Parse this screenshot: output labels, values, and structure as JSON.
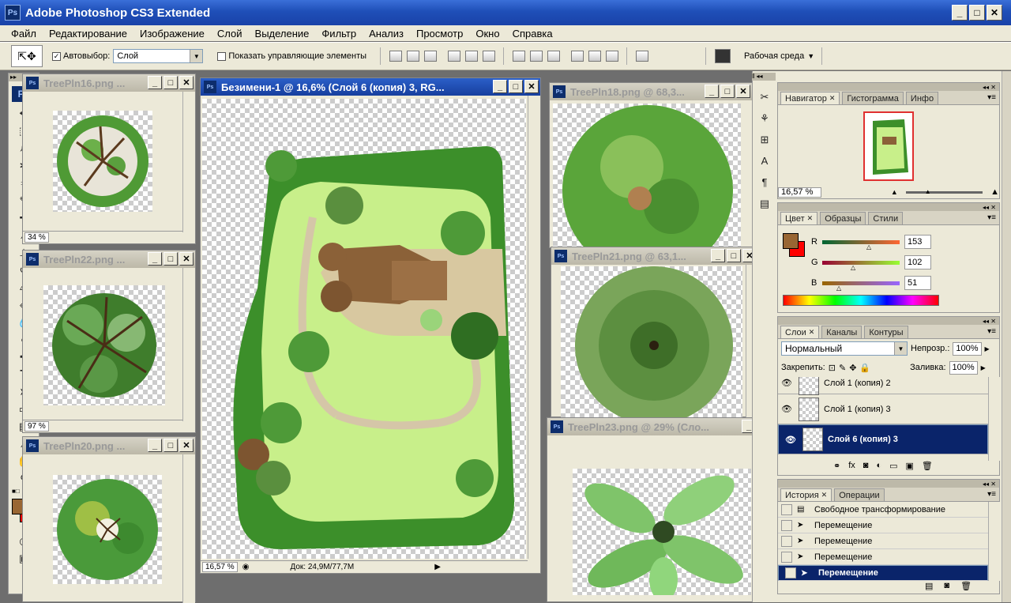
{
  "app": {
    "title": "Adobe Photoshop CS3 Extended",
    "logo": "Ps"
  },
  "menu": [
    "Файл",
    "Редактирование",
    "Изображение",
    "Слой",
    "Выделение",
    "Фильтр",
    "Анализ",
    "Просмотр",
    "Окно",
    "Справка"
  ],
  "options": {
    "auto_select_label": "Автовыбор:",
    "auto_select_value": "Слой",
    "show_controls_label": "Показать управляющие элементы",
    "workspace_label": "Рабочая среда"
  },
  "documents": {
    "tree16": {
      "title": "TreePln16.png ...",
      "zoom": "34 %"
    },
    "tree22": {
      "title": "TreePln22.png ...",
      "zoom": "97 %"
    },
    "tree20": {
      "title": "TreePln20.png ..."
    },
    "main": {
      "title": "Безимени-1 @ 16,6% (Слой 6 (копия) 3, RG...",
      "zoom": "16,57 %",
      "doc_info": "Док: 24,9M/77,7M"
    },
    "tree18": {
      "title": "TreePln18.png @ 68,3..."
    },
    "tree21": {
      "title": "TreePln21.png @ 63,1..."
    },
    "tree23": {
      "title": "TreePln23.png @ 29% (Сло..."
    }
  },
  "navigator": {
    "tabs": [
      "Навигатор",
      "Гистограмма",
      "Инфо"
    ],
    "zoom": "16,57 %"
  },
  "color": {
    "tabs": [
      "Цвет",
      "Образцы",
      "Стили"
    ],
    "channels": [
      {
        "name": "R",
        "value": "153"
      },
      {
        "name": "G",
        "value": "102"
      },
      {
        "name": "B",
        "value": "51"
      }
    ],
    "fg": "#996633",
    "bg": "#ff0000"
  },
  "layers": {
    "tabs": [
      "Слои",
      "Каналы",
      "Контуры"
    ],
    "blend_mode": "Нормальный",
    "opacity_label": "Непрозр.:",
    "opacity": "100%",
    "lock_label": "Закрепить:",
    "fill_label": "Заливка:",
    "fill": "100%",
    "items": [
      "Слой 1 (копия) 2",
      "Слой 1 (копия) 3",
      "Слой 6 (копия) 3"
    ]
  },
  "history": {
    "tabs": [
      "История",
      "Операции"
    ],
    "items": [
      "Свободное трансформирование",
      "Перемещение",
      "Перемещение",
      "Перемещение",
      "Перемещение"
    ]
  }
}
